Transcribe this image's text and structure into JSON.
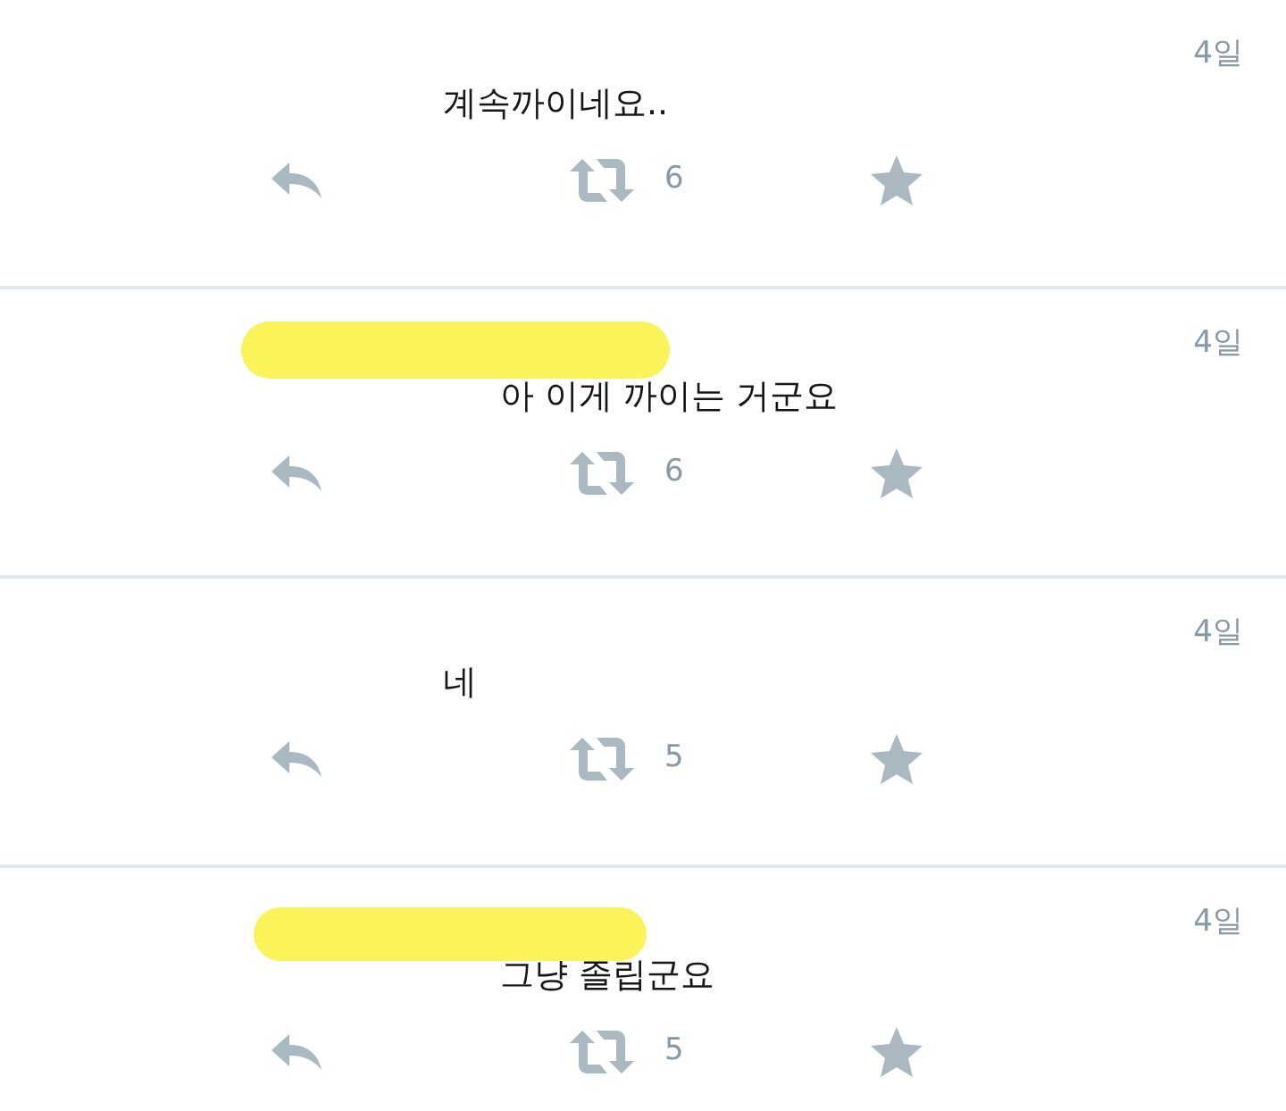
{
  "tweets": [
    {
      "kind": "plain",
      "date": "4일",
      "text": "계속까이네요..",
      "retweets": "6"
    },
    {
      "kind": "redacted",
      "date": "4일",
      "text": "아 이게 까이는 거군요",
      "retweets": "6"
    },
    {
      "kind": "plain",
      "date": "4일",
      "text": "네",
      "retweets": "5"
    },
    {
      "kind": "redacted",
      "date": "4일",
      "text": "그냥 졸립군요",
      "retweets": "5"
    }
  ]
}
